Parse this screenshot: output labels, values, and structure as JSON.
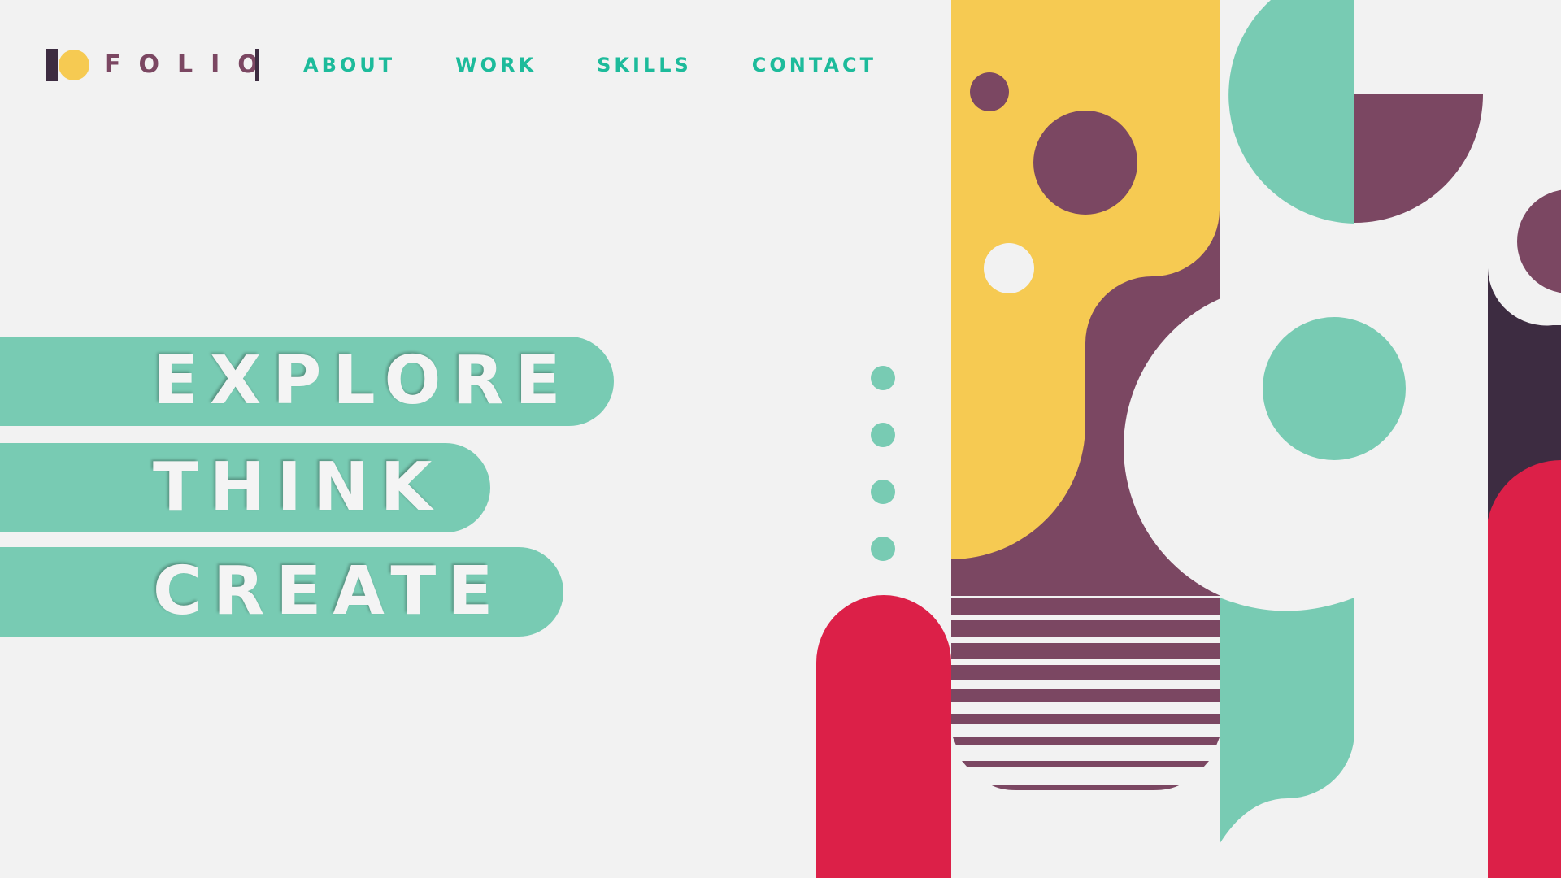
{
  "brand": {
    "name": "FOLIO"
  },
  "nav": {
    "items": [
      "ABOUT",
      "WORK",
      "SKILLS",
      "CONTACT"
    ]
  },
  "hero": {
    "words": [
      "EXPLORE",
      "THINK",
      "CREATE"
    ]
  },
  "colors": {
    "background": "#f2f2f2",
    "yellow": "#f6ca52",
    "plum": "#7b4762",
    "dark_plum": "#3d2c41",
    "teal": "#78cbb3",
    "teal_text": "#1dbb9b",
    "red": "#dc2048"
  }
}
